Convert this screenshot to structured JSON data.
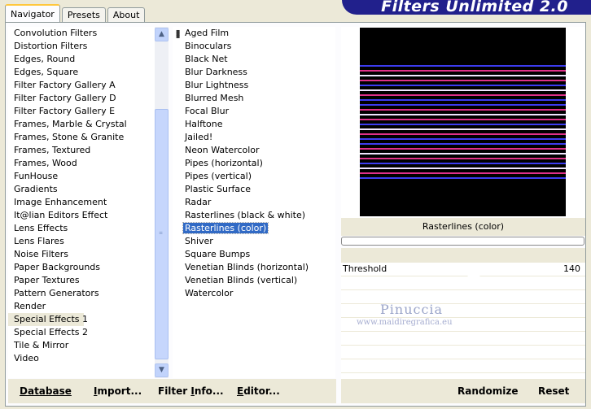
{
  "tabs": [
    {
      "label": "Navigator",
      "active": true
    },
    {
      "label": "Presets",
      "active": false
    },
    {
      "label": "About",
      "active": false
    }
  ],
  "brand": {
    "title": "Filters Unlimited 2.0",
    "color": "#21208c"
  },
  "categories": {
    "items": [
      "Convolution Filters",
      "Distortion Filters",
      "Edges, Round",
      "Edges, Square",
      "Filter Factory Gallery A",
      "Filter Factory Gallery D",
      "Filter Factory Gallery E",
      "Frames, Marble & Crystal",
      "Frames, Stone & Granite",
      "Frames, Textured",
      "Frames, Wood",
      "FunHouse",
      "Gradients",
      "Image Enhancement",
      "It@lian Editors Effect",
      "Lens Effects",
      "Lens Flares",
      "Noise Filters",
      "Paper Backgrounds",
      "Paper Textures",
      "Pattern Generators",
      "Render",
      "Special Effects 1",
      "Special Effects 2",
      "Tile & Mirror",
      "Video"
    ],
    "selected": "Special Effects 1"
  },
  "filters": {
    "items": [
      "Aged Film",
      "Binoculars",
      "Black Net",
      "Blur Darkness",
      "Blur Lightness",
      "Blurred Mesh",
      "Focal Blur",
      "Halftone",
      "Jailed!",
      "Neon Watercolor",
      "Pipes (horizontal)",
      "Pipes (vertical)",
      "Plastic Surface",
      "Radar",
      "Rasterlines (black & white)",
      "Rasterlines (color)",
      "Shiver",
      "Square Bumps",
      "Venetian Blinds (horizontal)",
      "Venetian Blinds (vertical)",
      "Watercolor"
    ],
    "selected": "Rasterlines (color)"
  },
  "preview": {
    "filter_name": "Rasterlines (color)"
  },
  "parameters": [
    {
      "label": "Threshold",
      "value": "140"
    }
  ],
  "watermark": {
    "name": "Pinuccia",
    "url": "www.maidiregrafica.eu"
  },
  "buttons": {
    "database": {
      "u": "D",
      "rest": "atabase"
    },
    "import": {
      "u": "I",
      "rest": "mport..."
    },
    "filter_info": {
      "pre": "Filter ",
      "u": "I",
      "rest": "nfo..."
    },
    "editor": {
      "u": "E",
      "rest": "ditor..."
    },
    "randomize": "Randomize",
    "reset": "Reset"
  },
  "colors": {
    "selection": "#316ac5",
    "stripe_pink": "#e0308a",
    "stripe_blue": "#3c3cf0",
    "stripe_white": "#f0e6ff"
  }
}
